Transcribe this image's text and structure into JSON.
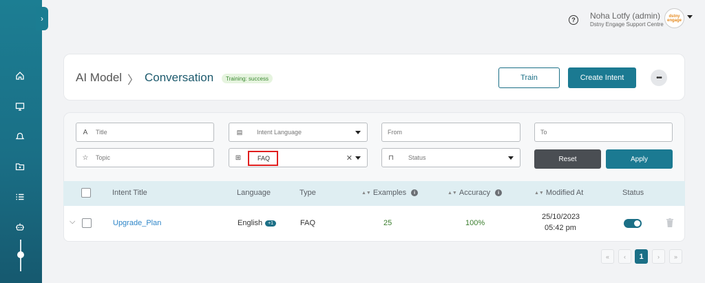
{
  "sidebar": {
    "toggle_icon": "chevron-right-icon",
    "icons": [
      "home-icon",
      "monitor-icon",
      "bell-icon",
      "folder-icon",
      "list-icon",
      "robot-icon"
    ]
  },
  "topbar": {
    "help_icon": "?",
    "user_name": "Noha Lotfy (admin)",
    "user_org": "Dstny Engage Support Centre",
    "avatar_text": "dstny engage"
  },
  "header": {
    "breadcrumb_root": "AI Model",
    "breadcrumb_sep": "〉",
    "breadcrumb_current": "Conversation",
    "training_badge": "Training: success",
    "train_label": "Train",
    "create_label": "Create Intent",
    "more_label": "•••"
  },
  "filters": {
    "title_placeholder": "Title",
    "topic_placeholder": "Topic",
    "intent_language_placeholder": "Intent Language",
    "type_value": "FAQ",
    "from_placeholder": "From",
    "to_placeholder": "To",
    "status_placeholder": "Status",
    "reset_label": "Reset",
    "apply_label": "Apply"
  },
  "table": {
    "columns": {
      "intent_title": "Intent Title",
      "language": "Language",
      "type": "Type",
      "examples": "Examples",
      "accuracy": "Accuracy",
      "modified_at": "Modified At",
      "status": "Status"
    },
    "rows": [
      {
        "intent_title": "Upgrade_Plan",
        "language": "English",
        "language_extra": "+1",
        "type": "FAQ",
        "examples": "25",
        "accuracy": "100%",
        "modified_date": "25/10/2023",
        "modified_time": "05:42 pm",
        "status_enabled": true
      }
    ]
  },
  "pagination": {
    "first": "«",
    "prev": "‹",
    "current": "1",
    "next": "›",
    "last": "»"
  },
  "colors": {
    "primary": "#1b7a92",
    "sidebar": "#1c7e93",
    "success_text": "#3c8a33",
    "success_bg": "#e6f4df",
    "highlight_border": "#e01e1e"
  }
}
